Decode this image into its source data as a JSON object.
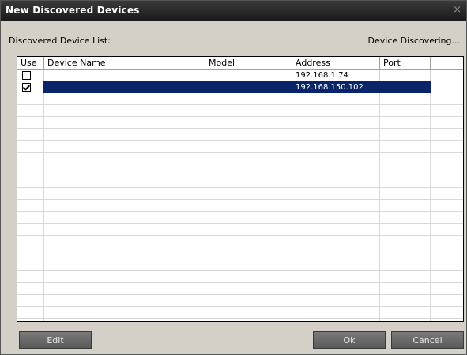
{
  "window": {
    "title": "New Discovered Devices",
    "close_glyph": "×"
  },
  "list_label": "Discovered Device List:",
  "status_text": "Device Discovering...",
  "columns": [
    "Use",
    "Device Name",
    "Model",
    "Address",
    "Port"
  ],
  "rows": [
    {
      "use": false,
      "device_name": "",
      "model": "",
      "address": "192.168.1.74",
      "port": "",
      "selected": false
    },
    {
      "use": true,
      "device_name": "",
      "model": "",
      "address": "192.168.150.102",
      "port": "",
      "selected": true
    }
  ],
  "buttons": {
    "edit": "Edit",
    "ok": "Ok",
    "cancel": "Cancel"
  },
  "colors": {
    "selection": "#0a246a",
    "titlebar": "#2a2a2a",
    "button": "#6a6a6a"
  }
}
